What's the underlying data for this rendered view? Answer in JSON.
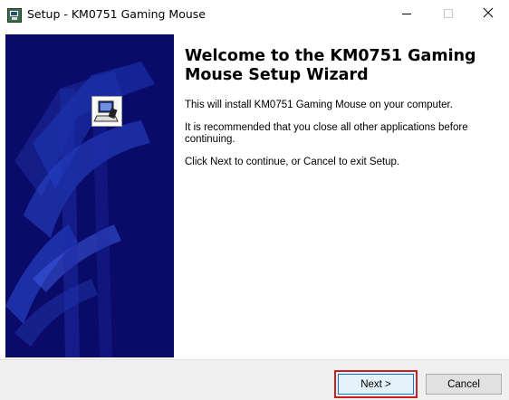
{
  "titlebar": {
    "title": "Setup - KM0751 Gaming Mouse",
    "app_icon": "setup-installer-icon",
    "controls": [
      "minimize-icon",
      "maximize-icon",
      "close-icon"
    ]
  },
  "sidebar": {
    "background": "#0a0a68",
    "icon": "computer-install-icon"
  },
  "main": {
    "heading": "Welcome to the KM0751 Gaming Mouse Setup Wizard",
    "paragraphs": [
      "This will install KM0751 Gaming Mouse on your computer.",
      "It is recommended that you close all other applications before continuing.",
      "Click Next to continue, or Cancel to exit Setup."
    ]
  },
  "footer": {
    "next_label": "Next >",
    "cancel_label": "Cancel",
    "highlight_color": "#cc1f1f",
    "focus_color": "#0078d7"
  }
}
